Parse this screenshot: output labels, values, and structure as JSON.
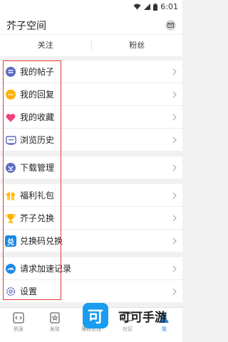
{
  "status_bar": {
    "time": "6:01"
  },
  "header": {
    "title": "芥子空间"
  },
  "tabs": [
    {
      "label": "关注"
    },
    {
      "label": "粉丝"
    }
  ],
  "menu_groups": [
    {
      "items": [
        {
          "label": "我的帖子",
          "icon": "posts-icon",
          "color": "#5c6bc0"
        },
        {
          "label": "我的回复",
          "icon": "reply-icon",
          "color": "#ffb300"
        },
        {
          "label": "我的收藏",
          "icon": "heart-icon",
          "color": "#ec407a"
        },
        {
          "label": "浏览历史",
          "icon": "history-icon",
          "color": "#5c6bc0"
        }
      ]
    },
    {
      "items": [
        {
          "label": "下载管理",
          "icon": "download-icon",
          "color": "#5c6bc0"
        }
      ]
    },
    {
      "items": [
        {
          "label": "福利礼包",
          "icon": "gift-icon",
          "color": "#ffb300"
        },
        {
          "label": "芥子兑换",
          "icon": "trophy-icon",
          "color": "#ffb300"
        },
        {
          "label": "兑换码兑换",
          "icon": "redeem-code-icon",
          "color": "#1e88e5",
          "glyph": "兑"
        }
      ]
    },
    {
      "items": [
        {
          "label": "请求加速记录",
          "icon": "speedup-icon",
          "color": "#1e88e5"
        },
        {
          "label": "设置",
          "icon": "settings-icon",
          "color": "#5c6bc0"
        }
      ]
    }
  ],
  "bottom_nav": [
    {
      "label": "资源",
      "icon": "resource-icon",
      "active": false
    },
    {
      "label": "发现",
      "icon": "discover-icon",
      "active": false
    },
    {
      "label": "薄荷花钱",
      "icon": "wallet-icon",
      "active": false
    },
    {
      "label": "社区",
      "icon": "community-icon",
      "active": false
    },
    {
      "label": "我",
      "icon": "profile-icon",
      "active": true
    }
  ],
  "watermark": {
    "logo_glyph": "可",
    "text": "可可手游"
  },
  "colors": {
    "accent": "#1e88e5",
    "highlight_box": "#e53935"
  }
}
